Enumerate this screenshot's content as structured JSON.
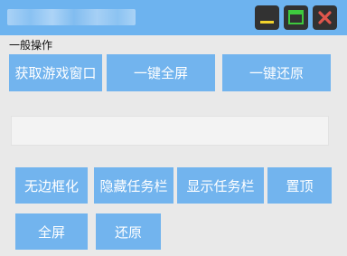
{
  "titlebar": {
    "controls": {
      "minimize": {
        "icon": "minimize-icon",
        "color": "#f2d32c"
      },
      "maximize": {
        "icon": "maximize-icon",
        "color": "#3ec93e"
      },
      "close": {
        "icon": "close-icon",
        "color": "#e0564c"
      }
    }
  },
  "section": {
    "label": "一般操作"
  },
  "buttons": {
    "get_window": "获取游戏窗口",
    "fullscreen_one_key": "一键全屏",
    "restore_one_key": "一键还原",
    "borderless": "无边框化",
    "hide_taskbar": "隐藏任务栏",
    "show_taskbar": "显示任务栏",
    "pin_top": "置顶",
    "fullscreen": "全屏",
    "restore": "还原"
  },
  "text_box": {
    "value": ""
  },
  "colors": {
    "titlebar": "#6db3ef",
    "button": "#72b4ee",
    "background": "#e9e9e9"
  }
}
